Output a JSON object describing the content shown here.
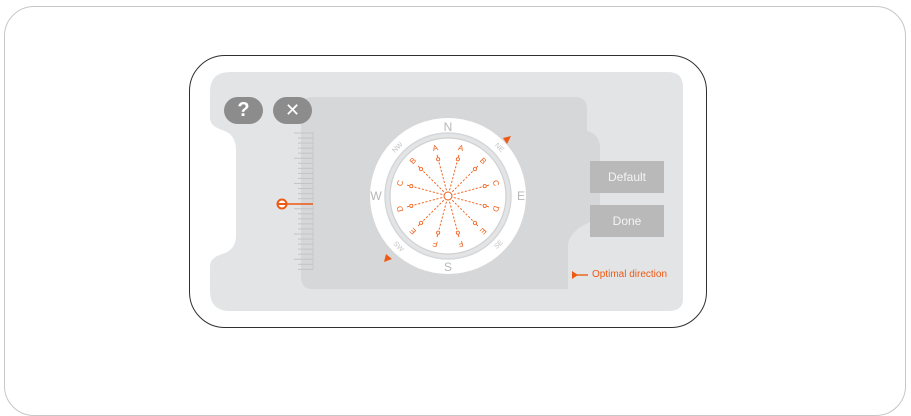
{
  "toolbar": {
    "help_label": "?",
    "close_label": "✕"
  },
  "buttons": {
    "default_label": "Default",
    "done_label": "Done"
  },
  "compass": {
    "cardinals": {
      "n": "N",
      "e": "E",
      "s": "S",
      "w": "W"
    },
    "intercardinals": {
      "ne": "NE",
      "se": "SE",
      "sw": "SW",
      "nw": "NW"
    },
    "spoke_labels_right": [
      "A",
      "B",
      "C",
      "D",
      "E",
      "F"
    ],
    "spoke_labels_left": [
      "A",
      "B",
      "C",
      "D",
      "E",
      "F"
    ]
  },
  "legend": {
    "optimal_direction_label": "Optimal direction"
  },
  "colors": {
    "accent": "#EE5A14",
    "screen_bg": "#E3E4E6",
    "panel_bg": "#D6D7D9",
    "button_bg": "#B9B9B9",
    "round_button_bg": "#8C8C8C"
  }
}
